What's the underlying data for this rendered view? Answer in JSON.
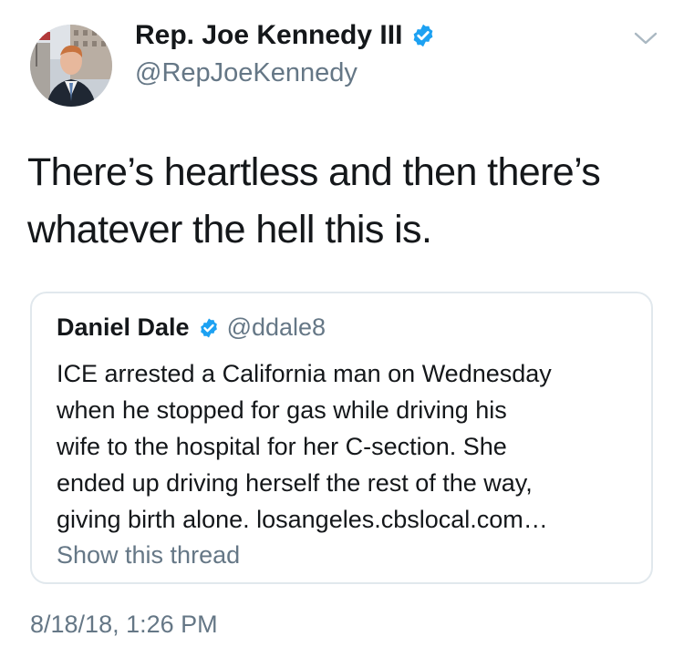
{
  "author": {
    "name": "Rep. Joe Kennedy III",
    "handle": "@RepJoeKennedy",
    "verified": true,
    "avatar_icon": "profile-photo"
  },
  "menu_icon": "chevron-down-icon",
  "tweet": {
    "text": "There’s heartless and then there’s whatever the hell this is.",
    "timestamp": "8/18/18, 1:26 PM"
  },
  "quoted_tweet": {
    "name": "Daniel Dale",
    "handle": "@ddale8",
    "verified": true,
    "text": "ICE arrested a California man on Wednesday\nwhen he stopped for gas while driving his\nwife to the hospital for her C-section. She\nended up driving herself the rest of the way,\ngiving birth alone. losangeles.cbslocal.com…",
    "show_thread": "Show this thread"
  },
  "colors": {
    "text_primary": "#14171a",
    "text_secondary": "#657786",
    "verified_blue": "#1da1f2",
    "border": "#e1e8ed",
    "chevron": "#aab8c2"
  }
}
